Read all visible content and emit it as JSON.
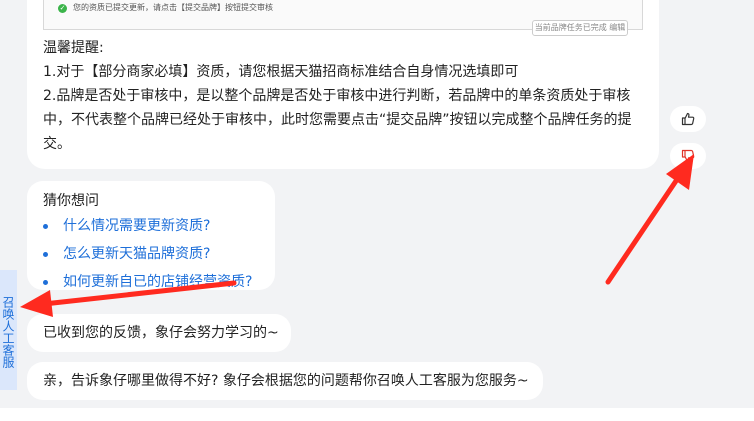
{
  "reply": {
    "screenshot_notice": "您的资质已提交更新，请点击【提交品牌】按钮提交审核",
    "screenshot_button": "当前品牌任务已完成 编辑",
    "tips_title": "温馨提醒:",
    "tip1": "1.对于【部分商家必填】资质，请您根据天猫招商标准结合自身情况选填即可",
    "tip2": "2.品牌是否处于审核中，是以整个品牌是否处于审核中进行判断，若品牌中的单条资质处于审核中，不代表整个品牌已经处于审核中，此时您需要点击“提交品牌”按钮以完成整个品牌任务的提交。"
  },
  "feedback": {
    "like_icon": "thumbs-up-icon",
    "dislike_icon": "thumbs-down-icon"
  },
  "suggestions": {
    "title": "猜你想问",
    "items": [
      "什么情况需要更新资质?",
      "怎么更新天猫品牌资质?",
      "如何更新自已的店铺经营资质?"
    ]
  },
  "messages": {
    "ack": "已收到您的反馈，象仔会努力学习的~",
    "ask": "亲，告诉象仔哪里做得不好? 象仔会根据您的问题帮你召唤人工客服为您服务~"
  },
  "side_tab": {
    "label": "召唤人工客服"
  },
  "colors": {
    "accent": "#1e6fd9",
    "arrow": "#ff2a1f",
    "background": "#f2f3f5"
  }
}
